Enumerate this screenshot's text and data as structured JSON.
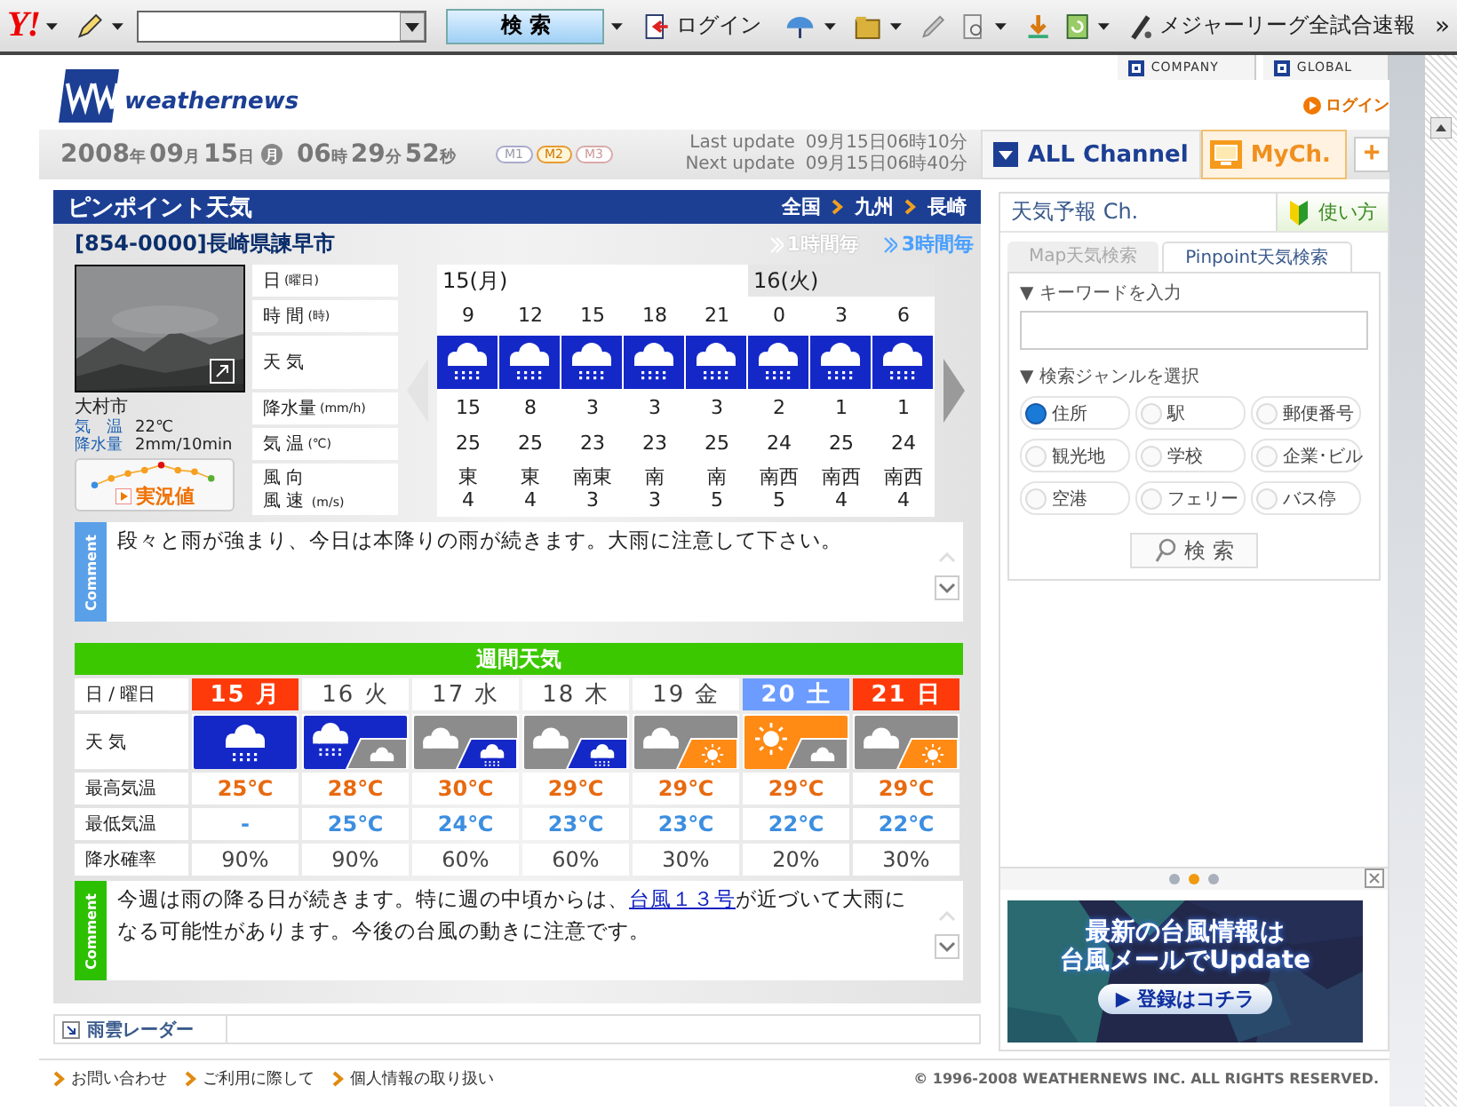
{
  "toolbar": {
    "logo": "Y!",
    "search_button": "検 索",
    "login": "ログイン",
    "news": "メジャーリーグ全試合速報",
    "more": "»"
  },
  "header": {
    "logo_text": "weathernews",
    "links": [
      "COMPANY",
      "GLOBAL"
    ],
    "login": "ログイン"
  },
  "datebar": {
    "parts": [
      {
        "text": "2008",
        "kind": "num"
      },
      {
        "text": "年",
        "kind": "unit"
      },
      {
        "text": "09",
        "kind": "num"
      },
      {
        "text": "月",
        "kind": "unit"
      },
      {
        "text": "15",
        "kind": "num"
      },
      {
        "text": "日",
        "kind": "unit"
      },
      {
        "text": "月",
        "kind": "badge"
      },
      {
        "text": "06",
        "kind": "num"
      },
      {
        "text": "時",
        "kind": "unit"
      },
      {
        "text": "29",
        "kind": "num"
      },
      {
        "text": "分",
        "kind": "unit"
      },
      {
        "text": "52",
        "kind": "num"
      },
      {
        "text": "秒",
        "kind": "unit"
      }
    ],
    "modes": [
      {
        "label": "M1",
        "selected": false
      },
      {
        "label": "M2",
        "selected": true
      },
      {
        "label": "M3",
        "selected": false
      }
    ],
    "updates": [
      {
        "label": "Last update",
        "value": "09月15日06時10分"
      },
      {
        "label": "Next update",
        "value": "09月15日06時40分"
      }
    ],
    "channels": {
      "all": "ALL Channel",
      "my": "MyCh.",
      "add": "+"
    }
  },
  "pinpoint": {
    "title": "ピンポイント天気",
    "breadcrumb": [
      "全国",
      "九州",
      "長崎"
    ],
    "location": "[854-0000]長崎県諫早市",
    "intervals": [
      {
        "label": "1時間毎",
        "selected": false
      },
      {
        "label": "3時間毎",
        "selected": true
      }
    ],
    "camera": {
      "city": "大村市",
      "stats": [
        {
          "label": "気　温",
          "value": "22℃"
        },
        {
          "label": "降水量",
          "value": "2mm/10min"
        }
      ],
      "button": "実況値"
    },
    "row_labels": [
      {
        "main": "日",
        "unit": "(曜日)"
      },
      {
        "main": "時 間",
        "unit": "(時)"
      },
      {
        "main": "天 気"
      },
      {
        "main": "降水量",
        "unit": "(mm/h)"
      },
      {
        "main": "気 温",
        "unit": "(℃)"
      },
      {
        "main": "風 向",
        "main2": "風 速",
        "unit": "(m/s)"
      }
    ],
    "days": [
      {
        "label": "15(月)",
        "slots": [
          {
            "hour": "9",
            "weather": {
              "kind": "rain"
            },
            "precip": "15",
            "temp": "25",
            "wind_dir": "東",
            "wind_speed": "4"
          },
          {
            "hour": "12",
            "weather": {
              "kind": "rain"
            },
            "precip": "8",
            "temp": "25",
            "wind_dir": "東",
            "wind_speed": "4"
          },
          {
            "hour": "15",
            "weather": {
              "kind": "rain"
            },
            "precip": "3",
            "temp": "23",
            "wind_dir": "南東",
            "wind_speed": "3"
          },
          {
            "hour": "18",
            "weather": {
              "kind": "rain"
            },
            "precip": "3",
            "temp": "23",
            "wind_dir": "南",
            "wind_speed": "3"
          },
          {
            "hour": "21",
            "weather": {
              "kind": "rain"
            },
            "precip": "3",
            "temp": "25",
            "wind_dir": "南",
            "wind_speed": "5"
          }
        ]
      },
      {
        "label": "16(火)",
        "slots": [
          {
            "hour": "0",
            "weather": {
              "kind": "rain"
            },
            "precip": "2",
            "temp": "24",
            "wind_dir": "南西",
            "wind_speed": "5"
          },
          {
            "hour": "3",
            "weather": {
              "kind": "rain"
            },
            "precip": "1",
            "temp": "25",
            "wind_dir": "南西",
            "wind_speed": "4"
          },
          {
            "hour": "6",
            "weather": {
              "kind": "rain"
            },
            "precip": "1",
            "temp": "24",
            "wind_dir": "南西",
            "wind_speed": "4"
          }
        ]
      }
    ],
    "comment_label": "Comment",
    "comment": "段々と雨が強まり、今日は本降りの雨が続きます。大雨に注意して下さい。"
  },
  "weekly": {
    "title": "週間天気",
    "row_labels": [
      "日 / 曜日",
      "天 気",
      "最高気温",
      "最低気温",
      "降水確率"
    ],
    "days": [
      {
        "date": "15",
        "weekday": "月",
        "kind": "holiday",
        "weather": [
          {
            "kind": "rain"
          }
        ],
        "high": "25℃",
        "low": "-",
        "pop": "90%"
      },
      {
        "date": "16",
        "weekday": "火",
        "kind": "weekday",
        "weather": [
          {
            "kind": "rain"
          },
          {
            "kind": "cloud"
          }
        ],
        "high": "28℃",
        "low": "25℃",
        "pop": "90%"
      },
      {
        "date": "17",
        "weekday": "水",
        "kind": "weekday",
        "weather": [
          {
            "kind": "cloud"
          },
          {
            "kind": "rain"
          }
        ],
        "high": "30℃",
        "low": "24℃",
        "pop": "60%"
      },
      {
        "date": "18",
        "weekday": "木",
        "kind": "weekday",
        "weather": [
          {
            "kind": "cloud"
          },
          {
            "kind": "rain"
          }
        ],
        "high": "29℃",
        "low": "23℃",
        "pop": "60%"
      },
      {
        "date": "19",
        "weekday": "金",
        "kind": "weekday",
        "weather": [
          {
            "kind": "cloud"
          },
          {
            "kind": "sun"
          }
        ],
        "high": "29℃",
        "low": "23℃",
        "pop": "30%"
      },
      {
        "date": "20",
        "weekday": "土",
        "kind": "saturday",
        "weather": [
          {
            "kind": "sun"
          },
          {
            "kind": "cloud"
          }
        ],
        "high": "29℃",
        "low": "22℃",
        "pop": "20%"
      },
      {
        "date": "21",
        "weekday": "日",
        "kind": "holiday",
        "weather": [
          {
            "kind": "cloud"
          },
          {
            "kind": "sun"
          }
        ],
        "high": "29℃",
        "low": "22℃",
        "pop": "30%"
      }
    ],
    "comment_label": "Comment",
    "comment": {
      "before": "今週は雨の降る日が続きます。特に週の中頃からは、",
      "link": "台風１３号",
      "after": "が近づいて大雨になる可能性があります。今後の台風の動きに注意です。"
    }
  },
  "radar": {
    "label": "雨雲レーダー"
  },
  "channel_panel": {
    "title": "天気予報 Ch.",
    "help": "使い方",
    "tabs": [
      {
        "label": "Map天気検索",
        "selected": false
      },
      {
        "label": "Pinpoint天気検索",
        "selected": true
      }
    ],
    "keyword_label": "▼ キーワードを入力",
    "genre_label": "▼ 検索ジャンルを選択",
    "genres": [
      {
        "label": "住所",
        "selected": true
      },
      {
        "label": "駅",
        "selected": false
      },
      {
        "label": "郵便番号",
        "selected": false
      },
      {
        "label": "観光地",
        "selected": false
      },
      {
        "label": "学校",
        "selected": false
      },
      {
        "label": "企業･ビル",
        "selected": false
      },
      {
        "label": "空港",
        "selected": false
      },
      {
        "label": "フェリー",
        "selected": false
      },
      {
        "label": "バス停",
        "selected": false
      }
    ],
    "search_button": "検 索",
    "pager": [
      {
        "selected": false
      },
      {
        "selected": true
      },
      {
        "selected": false
      }
    ],
    "banner": {
      "lines": [
        "最新の台風情報は",
        "台風メールでUpdate"
      ],
      "button": "▶ 登録はコチラ"
    }
  },
  "footer": {
    "links": [
      "お問い合わせ",
      "ご利用に際して",
      "個人情報の取り扱い"
    ],
    "copyright": "© 1996-2008 WEATHERNEWS INC. ALL RIGHTS RESERVED."
  }
}
